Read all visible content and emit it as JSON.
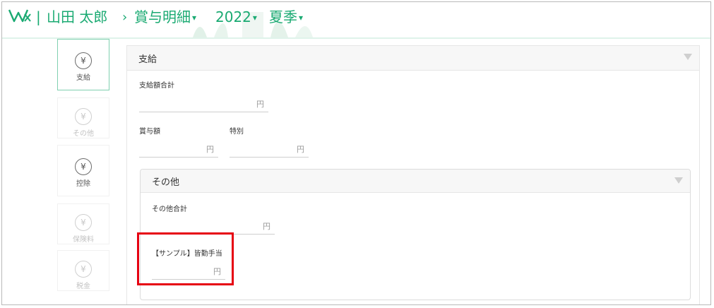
{
  "header": {
    "logo": "Wx-logo",
    "separator": "|",
    "user_name": "山田 太郎",
    "chevron": "›",
    "breadcrumb": "賞与明細",
    "year": "2022",
    "season": "夏季",
    "dropdown_marker": "▾",
    "accent_color": "#1aaa72"
  },
  "sidebar": {
    "items": [
      {
        "icon": "yen-icon",
        "glyph": "¥",
        "label": "支給"
      },
      {
        "icon": "yen-icon",
        "glyph": "¥",
        "label": "その他"
      },
      {
        "icon": "yen-icon",
        "glyph": "¥",
        "label": "控除"
      },
      {
        "icon": "yen-icon",
        "glyph": "¥",
        "label": "保険料"
      },
      {
        "icon": "yen-icon",
        "glyph": "¥",
        "label": "税金"
      }
    ]
  },
  "main": {
    "title": "支給",
    "fields": {
      "total": {
        "label": "支給額合計",
        "unit": "円"
      },
      "bonus": {
        "label": "賞与額",
        "unit": "円"
      },
      "special": {
        "label": "特別",
        "unit": "円"
      }
    },
    "other": {
      "title": "その他",
      "total": {
        "label": "その他合計",
        "unit": "円"
      },
      "sample": {
        "label": "【サンプル】皆勤手当",
        "unit": "円"
      }
    }
  },
  "highlight_color": "#e60012"
}
